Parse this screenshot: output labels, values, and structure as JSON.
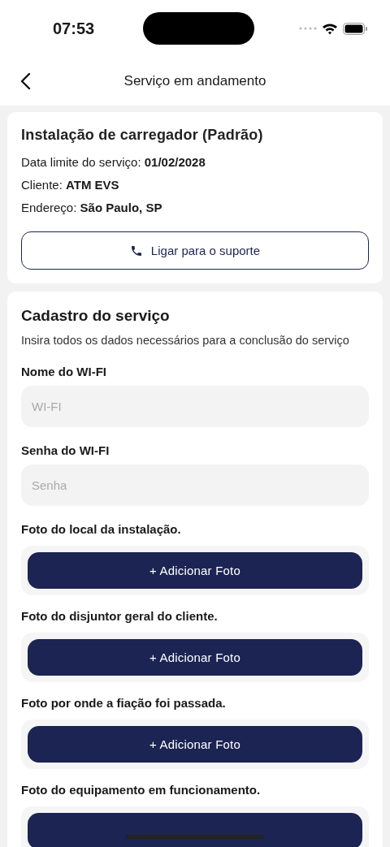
{
  "status_bar": {
    "time": "07:53"
  },
  "header": {
    "title": "Serviço em andamento"
  },
  "service": {
    "title": "Instalação de carregador (Padrão)",
    "details": [
      {
        "label": "Data limite do serviço: ",
        "value": "01/02/2028"
      },
      {
        "label": "Cliente: ",
        "value": "ATM EVS"
      },
      {
        "label": "Endereço: ",
        "value": "São Paulo, SP"
      }
    ],
    "support_button": "Ligar para o suporte"
  },
  "form": {
    "title": "Cadastro do serviço",
    "description": "Insira todos os dados necessários para a conclusão do serviço",
    "fields": [
      {
        "label": "Nome do WI-FI",
        "placeholder": "WI-FI"
      },
      {
        "label": "Senha do WI-FI",
        "placeholder": "Senha"
      }
    ],
    "photos": [
      {
        "label": "Foto do local da instalação.",
        "button": "+ Adicionar Foto"
      },
      {
        "label": "Foto do disjuntor geral do cliente.",
        "button": "+ Adicionar Foto"
      },
      {
        "label": "Foto por onde a fiação foi passada.",
        "button": "+ Adicionar Foto"
      },
      {
        "label": "Foto do equipamento em funcionamento."
      }
    ]
  }
}
